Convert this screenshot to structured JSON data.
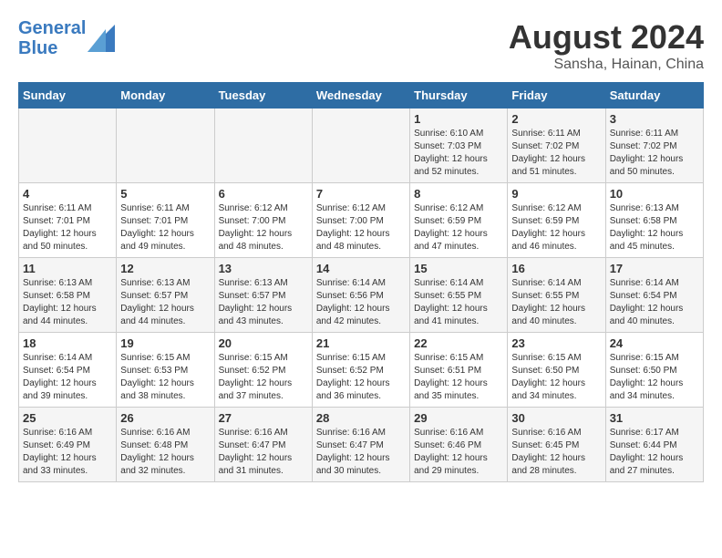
{
  "header": {
    "logo_line1": "General",
    "logo_line2": "Blue",
    "month_year": "August 2024",
    "location": "Sansha, Hainan, China"
  },
  "days_of_week": [
    "Sunday",
    "Monday",
    "Tuesday",
    "Wednesday",
    "Thursday",
    "Friday",
    "Saturday"
  ],
  "weeks": [
    [
      {
        "day": "",
        "info": ""
      },
      {
        "day": "",
        "info": ""
      },
      {
        "day": "",
        "info": ""
      },
      {
        "day": "",
        "info": ""
      },
      {
        "day": "1",
        "info": "Sunrise: 6:10 AM\nSunset: 7:03 PM\nDaylight: 12 hours and 52 minutes."
      },
      {
        "day": "2",
        "info": "Sunrise: 6:11 AM\nSunset: 7:02 PM\nDaylight: 12 hours and 51 minutes."
      },
      {
        "day": "3",
        "info": "Sunrise: 6:11 AM\nSunset: 7:02 PM\nDaylight: 12 hours and 50 minutes."
      }
    ],
    [
      {
        "day": "4",
        "info": "Sunrise: 6:11 AM\nSunset: 7:01 PM\nDaylight: 12 hours and 50 minutes."
      },
      {
        "day": "5",
        "info": "Sunrise: 6:11 AM\nSunset: 7:01 PM\nDaylight: 12 hours and 49 minutes."
      },
      {
        "day": "6",
        "info": "Sunrise: 6:12 AM\nSunset: 7:00 PM\nDaylight: 12 hours and 48 minutes."
      },
      {
        "day": "7",
        "info": "Sunrise: 6:12 AM\nSunset: 7:00 PM\nDaylight: 12 hours and 48 minutes."
      },
      {
        "day": "8",
        "info": "Sunrise: 6:12 AM\nSunset: 6:59 PM\nDaylight: 12 hours and 47 minutes."
      },
      {
        "day": "9",
        "info": "Sunrise: 6:12 AM\nSunset: 6:59 PM\nDaylight: 12 hours and 46 minutes."
      },
      {
        "day": "10",
        "info": "Sunrise: 6:13 AM\nSunset: 6:58 PM\nDaylight: 12 hours and 45 minutes."
      }
    ],
    [
      {
        "day": "11",
        "info": "Sunrise: 6:13 AM\nSunset: 6:58 PM\nDaylight: 12 hours and 44 minutes."
      },
      {
        "day": "12",
        "info": "Sunrise: 6:13 AM\nSunset: 6:57 PM\nDaylight: 12 hours and 44 minutes."
      },
      {
        "day": "13",
        "info": "Sunrise: 6:13 AM\nSunset: 6:57 PM\nDaylight: 12 hours and 43 minutes."
      },
      {
        "day": "14",
        "info": "Sunrise: 6:14 AM\nSunset: 6:56 PM\nDaylight: 12 hours and 42 minutes."
      },
      {
        "day": "15",
        "info": "Sunrise: 6:14 AM\nSunset: 6:55 PM\nDaylight: 12 hours and 41 minutes."
      },
      {
        "day": "16",
        "info": "Sunrise: 6:14 AM\nSunset: 6:55 PM\nDaylight: 12 hours and 40 minutes."
      },
      {
        "day": "17",
        "info": "Sunrise: 6:14 AM\nSunset: 6:54 PM\nDaylight: 12 hours and 40 minutes."
      }
    ],
    [
      {
        "day": "18",
        "info": "Sunrise: 6:14 AM\nSunset: 6:54 PM\nDaylight: 12 hours and 39 minutes."
      },
      {
        "day": "19",
        "info": "Sunrise: 6:15 AM\nSunset: 6:53 PM\nDaylight: 12 hours and 38 minutes."
      },
      {
        "day": "20",
        "info": "Sunrise: 6:15 AM\nSunset: 6:52 PM\nDaylight: 12 hours and 37 minutes."
      },
      {
        "day": "21",
        "info": "Sunrise: 6:15 AM\nSunset: 6:52 PM\nDaylight: 12 hours and 36 minutes."
      },
      {
        "day": "22",
        "info": "Sunrise: 6:15 AM\nSunset: 6:51 PM\nDaylight: 12 hours and 35 minutes."
      },
      {
        "day": "23",
        "info": "Sunrise: 6:15 AM\nSunset: 6:50 PM\nDaylight: 12 hours and 34 minutes."
      },
      {
        "day": "24",
        "info": "Sunrise: 6:15 AM\nSunset: 6:50 PM\nDaylight: 12 hours and 34 minutes."
      }
    ],
    [
      {
        "day": "25",
        "info": "Sunrise: 6:16 AM\nSunset: 6:49 PM\nDaylight: 12 hours and 33 minutes."
      },
      {
        "day": "26",
        "info": "Sunrise: 6:16 AM\nSunset: 6:48 PM\nDaylight: 12 hours and 32 minutes."
      },
      {
        "day": "27",
        "info": "Sunrise: 6:16 AM\nSunset: 6:47 PM\nDaylight: 12 hours and 31 minutes."
      },
      {
        "day": "28",
        "info": "Sunrise: 6:16 AM\nSunset: 6:47 PM\nDaylight: 12 hours and 30 minutes."
      },
      {
        "day": "29",
        "info": "Sunrise: 6:16 AM\nSunset: 6:46 PM\nDaylight: 12 hours and 29 minutes."
      },
      {
        "day": "30",
        "info": "Sunrise: 6:16 AM\nSunset: 6:45 PM\nDaylight: 12 hours and 28 minutes."
      },
      {
        "day": "31",
        "info": "Sunrise: 6:17 AM\nSunset: 6:44 PM\nDaylight: 12 hours and 27 minutes."
      }
    ]
  ]
}
